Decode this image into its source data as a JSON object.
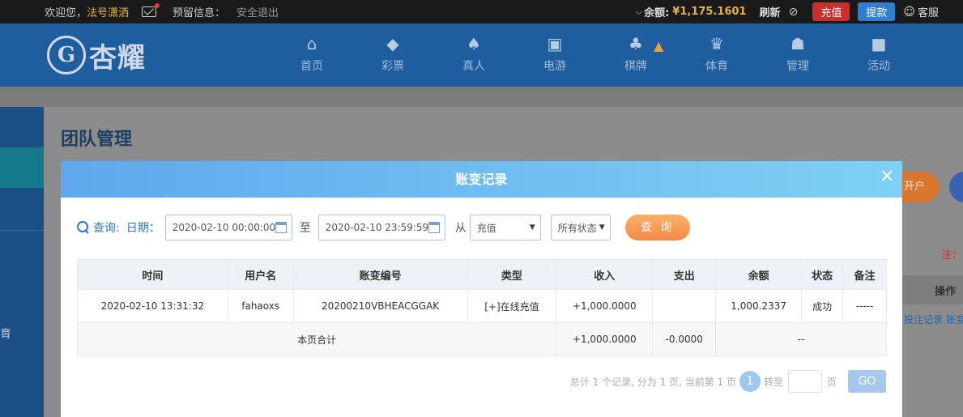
{
  "topbar": {
    "welcome": "欢迎您，",
    "username": "法号潇洒",
    "reserved_label": "预留信息：",
    "logout": "安全退出",
    "balance_label": "余额:",
    "balance": "¥1,175.1601",
    "refresh": "刷新",
    "deposit": "充值",
    "withdraw": "提款",
    "service": "客服"
  },
  "logo": {
    "text": "杏耀",
    "emblem": "G"
  },
  "nav": {
    "items": [
      {
        "label": "首页",
        "icon": "home-icon",
        "glyph": "⌂"
      },
      {
        "label": "彩票",
        "icon": "ticket-icon",
        "glyph": "◆"
      },
      {
        "label": "真人",
        "icon": "dealer-icon",
        "glyph": "♠"
      },
      {
        "label": "电游",
        "icon": "slot-machine-icon",
        "glyph": "▣"
      },
      {
        "label": "棋牌",
        "icon": "cards-icon",
        "glyph": "♣"
      },
      {
        "label": "体育",
        "icon": "trophy-icon",
        "glyph": "♛"
      },
      {
        "label": "管理",
        "icon": "users-icon",
        "glyph": "☗"
      },
      {
        "label": "活动",
        "icon": "gift-icon",
        "glyph": "■"
      }
    ]
  },
  "page": {
    "title": "团队管理",
    "side_label": "育",
    "open_account_partial": "开户",
    "note_partial": "注：",
    "op_header": "操作",
    "row_links": "投注记录  账变"
  },
  "modal": {
    "title": "账变记录",
    "close": "×",
    "filter": {
      "query_label": "查询:",
      "date_label": "日期：",
      "start": "2020-02-10 00:00:00",
      "to": "至",
      "end": "2020-02-10 23:59:59",
      "from": "从",
      "type_value": "充值",
      "status_value": "所有状态",
      "query_button": "查 询"
    },
    "table": {
      "headers": [
        "时间",
        "用户名",
        "账变编号",
        "类型",
        "收入",
        "支出",
        "余额",
        "状态",
        "备注"
      ],
      "rows": [
        {
          "time": "2020-02-10 13:31:32",
          "user": "fahaoxs",
          "id": "20200210VBHEACGGAK",
          "type": "[+]在线充值",
          "income": "+1,000.0000",
          "expense": "",
          "balance": "1,000.2337",
          "status": "成功",
          "remark": "-----"
        }
      ],
      "summary": {
        "label": "本页合计",
        "income": "+1,000.0000",
        "expense": "-0.0000",
        "rest": "--"
      }
    },
    "pager": {
      "info": "总计 1 个记录, 分为 1 页, 当前第 1 页",
      "current": "1",
      "goto": "转至",
      "page_unit": "页",
      "go": "GO"
    }
  }
}
